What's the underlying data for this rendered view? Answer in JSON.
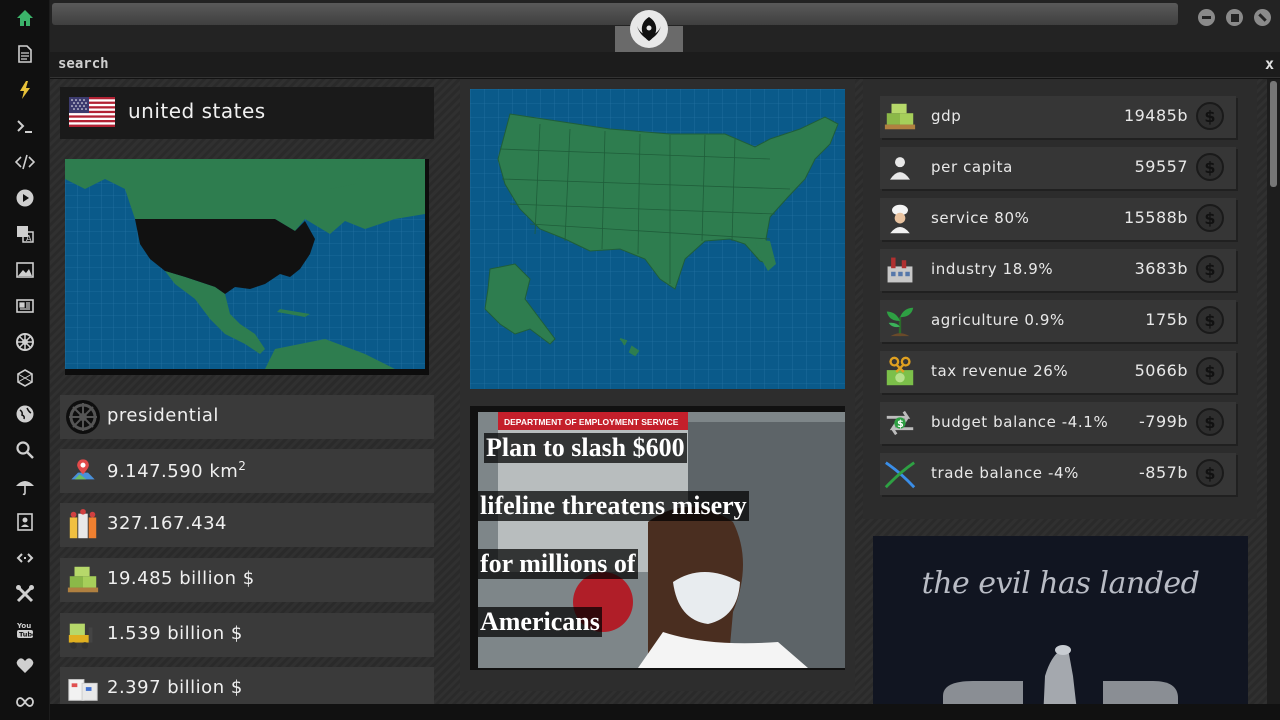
{
  "sidebar": {
    "icons": [
      "home-icon",
      "document-icon",
      "lightning-icon",
      "terminal-icon",
      "code-icon",
      "play-icon",
      "translate-icon",
      "image-icon",
      "news-icon",
      "empire-icon",
      "hexagon-icon",
      "globe-icon",
      "search-icon",
      "umbrella-icon",
      "contact-icon",
      "link-icon",
      "tools-icon",
      "youtube-icon",
      "heart-icon",
      "infinity-icon"
    ]
  },
  "search": {
    "label": "search",
    "close": "x"
  },
  "country": {
    "name": "united states",
    "government": "presidential",
    "area": "9.147.590 km",
    "area_sup": "2",
    "population": "327.167.434",
    "gdp": "19.485 billion $",
    "stat2": "1.539 billion $",
    "stat3": "2.397 billion $"
  },
  "news": {
    "sign_text": "DEPARTMENT OF EMPLOYMENT SERVICE",
    "lines": [
      "Plan to slash $600",
      "lifeline threatens misery",
      "for millions of",
      "Americans"
    ]
  },
  "economy": [
    {
      "label": "gdp",
      "value": "19485b",
      "icon": "cash-pallet-icon"
    },
    {
      "label": "per capita",
      "value": "59557",
      "icon": "person-icon"
    },
    {
      "label": "service 80%",
      "value": "15588b",
      "icon": "chef-icon"
    },
    {
      "label": "industry 18.9%",
      "value": "3683b",
      "icon": "factory-icon"
    },
    {
      "label": "agriculture 0.9%",
      "value": "175b",
      "icon": "plant-icon"
    },
    {
      "label": "tax revenue 26%",
      "value": "5066b",
      "icon": "money-cut-icon"
    },
    {
      "label": "budget balance -4.1%",
      "value": "-799b",
      "icon": "budget-arrows-icon"
    },
    {
      "label": "trade balance -4%",
      "value": "-857b",
      "icon": "trade-cross-icon"
    }
  ],
  "promo": {
    "text": "the evil has landed"
  },
  "colors": {
    "ocean": "#0a5a8a",
    "land": "#2e7d4f",
    "highlight": "#111111",
    "accent_green": "#2ea043"
  }
}
